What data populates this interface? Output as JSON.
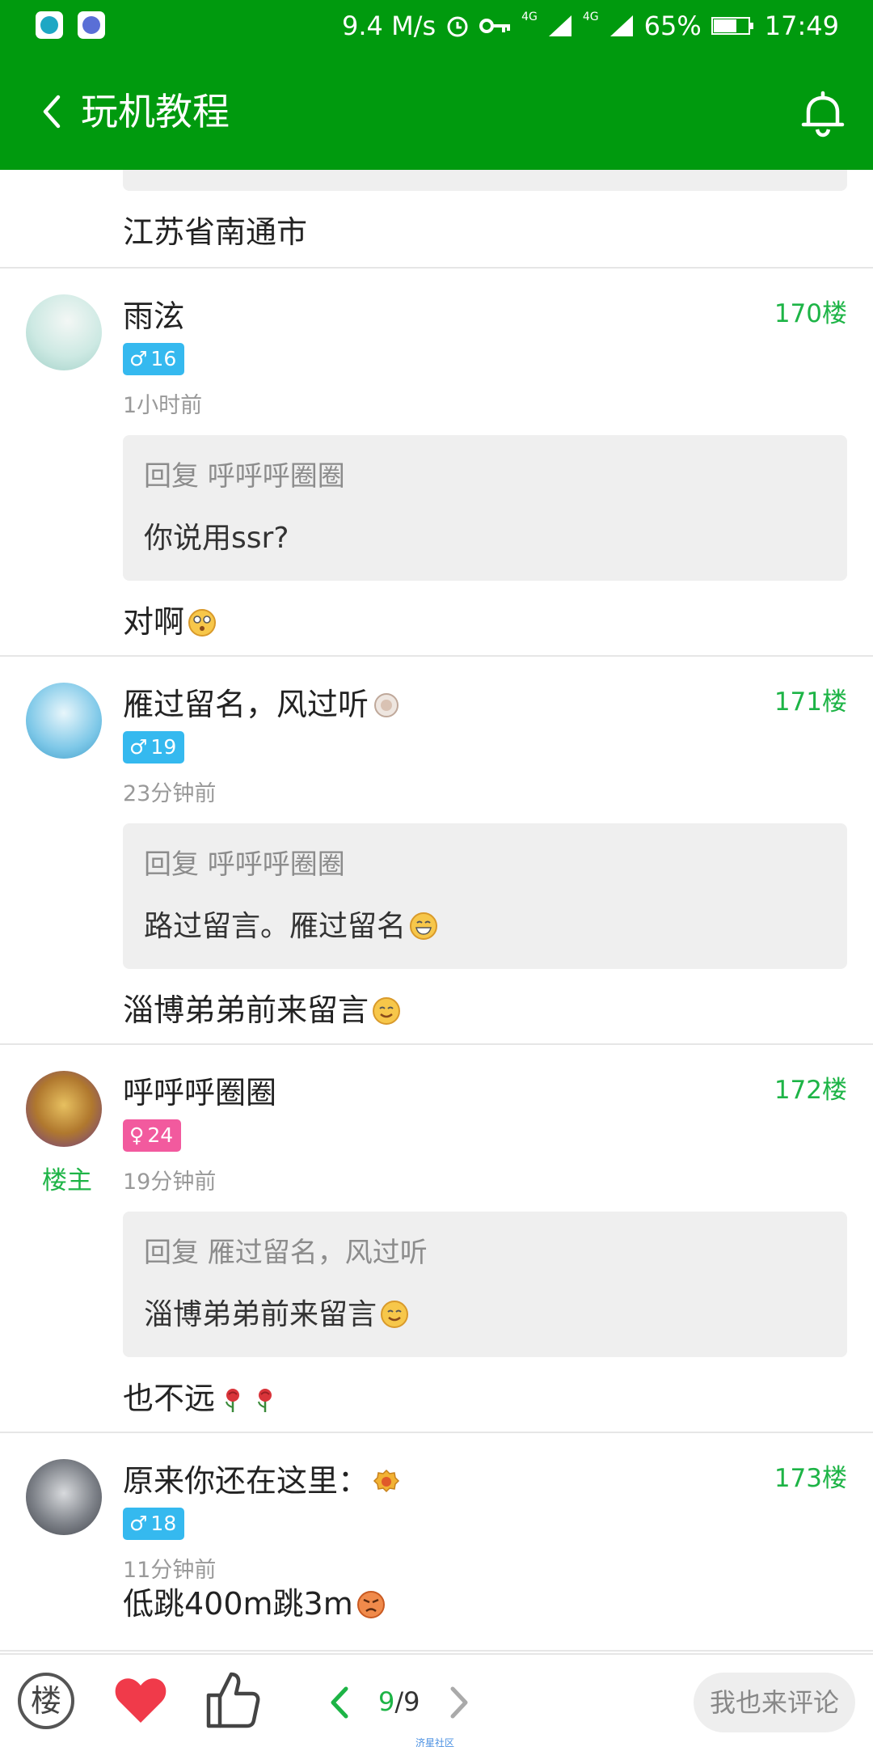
{
  "status_bar": {
    "speed": "9.4 M/s",
    "net1": "4G",
    "net2": "4G",
    "battery": "65%",
    "time": "17:49"
  },
  "header": {
    "title": "玩机教程"
  },
  "previous_post": {
    "location": "江苏省南通市"
  },
  "posts": [
    {
      "name": "雨泫",
      "gender": "male",
      "gender_symbol": "♂",
      "level": "16",
      "time": "1小时前",
      "floor": "170楼",
      "quote_head": "回复 呼呼呼圈圈",
      "quote_body": "你说用ssr?",
      "reply": "对啊",
      "avatar_color": "#cde9e3"
    },
    {
      "name": "雁过留名，风过听",
      "gender": "male",
      "gender_symbol": "♂",
      "level": "19",
      "time": "23分钟前",
      "floor": "171楼",
      "quote_head": "回复 呼呼呼圈圈",
      "quote_body": "路过留言。雁过留名",
      "reply": "淄博弟弟前来留言",
      "avatar_color": "#7ec8e8"
    },
    {
      "name": "呼呼呼圈圈",
      "gender": "female",
      "gender_symbol": "♀",
      "level": "24",
      "time": "19分钟前",
      "floor": "172楼",
      "author_badge": "楼主",
      "quote_head": "回复 雁过留名，风过听",
      "quote_body": "淄博弟弟前来留言",
      "reply": "也不远",
      "avatar_color": "#b0782e"
    },
    {
      "name": "原来你还在这里：",
      "gender": "male",
      "gender_symbol": "♂",
      "level": "18",
      "time": "11分钟前",
      "floor": "173楼",
      "reply": "低跳400m跳3m",
      "avatar_color": "#7d8188"
    }
  ],
  "bottom_bar": {
    "floor_button": "楼",
    "page_current": "9",
    "page_total": "/9",
    "comment_placeholder": "我也来评论",
    "watermark": "济星社区"
  },
  "colors": {
    "brand_green": "#009a0e",
    "floor_green": "#1db446",
    "male_badge": "#35b9ef",
    "female_badge": "#f25a9e",
    "heart_red": "#f03a4a"
  }
}
